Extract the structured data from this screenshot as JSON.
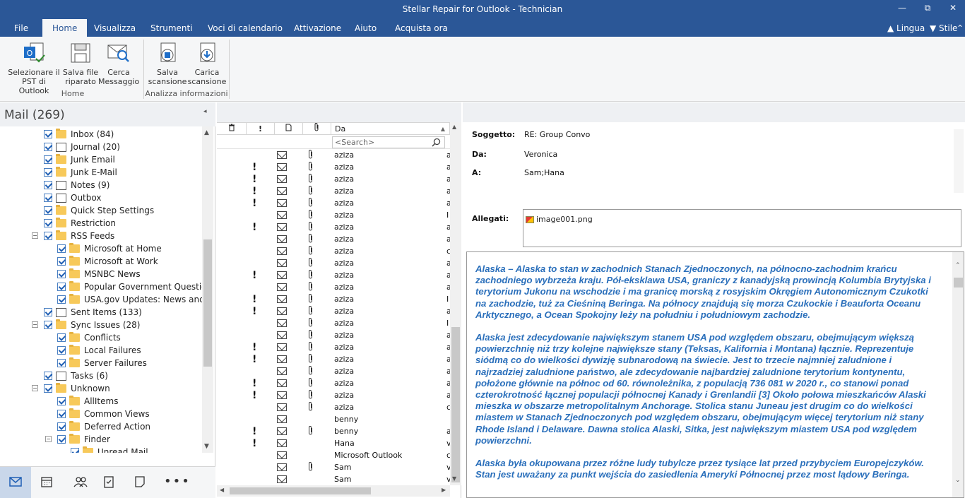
{
  "window": {
    "title": "Stellar Repair for Outlook - Technician",
    "controls": {
      "minimize": "—",
      "restore": "⧉",
      "close": "✕"
    }
  },
  "menu": {
    "items": [
      "File",
      "Home",
      "Visualizza",
      "Strumenti",
      "Voci di calendario",
      "Attivazione",
      "Aiuto",
      "Acquista ora"
    ],
    "active": "Home",
    "lingua": "▲ Lingua",
    "stile": "▼ Stile",
    "collapse": "⌃"
  },
  "ribbon": {
    "buttons": [
      {
        "line1": "Selezionare il",
        "line2": "PST di Outlook"
      },
      {
        "line1": "Salva file",
        "line2": "riparato"
      },
      {
        "line1": "Cerca",
        "line2": "Messaggio"
      },
      {
        "line1": "Salva",
        "line2": "scansione"
      },
      {
        "line1": "Carica",
        "line2": "scansione"
      }
    ],
    "groups": [
      "Home",
      "Analizza informazioni"
    ]
  },
  "left": {
    "mail_title": "Mail (269)",
    "collapse": "◂",
    "tree": [
      {
        "label": "Inbox (84)",
        "icon": "inbox",
        "indent": 1
      },
      {
        "label": "Journal (20)",
        "icon": "journal",
        "indent": 1
      },
      {
        "label": "Junk Email",
        "icon": "folder",
        "indent": 1
      },
      {
        "label": "Junk E-Mail",
        "icon": "folder",
        "indent": 1
      },
      {
        "label": "Notes (9)",
        "icon": "note",
        "indent": 1
      },
      {
        "label": "Outbox",
        "icon": "outbox",
        "indent": 1
      },
      {
        "label": "Quick Step Settings",
        "icon": "folder",
        "indent": 1
      },
      {
        "label": "Restriction",
        "icon": "folder",
        "indent": 1
      },
      {
        "label": "RSS Feeds",
        "icon": "folder",
        "indent": 1,
        "expander": "−"
      },
      {
        "label": "Microsoft at Home",
        "icon": "folder",
        "indent": 2
      },
      {
        "label": "Microsoft at Work",
        "icon": "folder",
        "indent": 2
      },
      {
        "label": "MSNBC News",
        "icon": "folder",
        "indent": 2
      },
      {
        "label": "Popular Government Questions",
        "icon": "folder",
        "indent": 2
      },
      {
        "label": "USA.gov Updates: News and Features",
        "icon": "folder",
        "indent": 2
      },
      {
        "label": "Sent Items (133)",
        "icon": "sent",
        "indent": 1
      },
      {
        "label": "Sync Issues (28)",
        "icon": "folder",
        "indent": 1,
        "expander": "−"
      },
      {
        "label": "Conflicts",
        "icon": "folder",
        "indent": 2
      },
      {
        "label": "Local Failures",
        "icon": "folder",
        "indent": 2
      },
      {
        "label": "Server Failures",
        "icon": "folder",
        "indent": 2
      },
      {
        "label": "Tasks (6)",
        "icon": "tasks",
        "indent": 1
      },
      {
        "label": "Unknown",
        "icon": "folder",
        "indent": 1,
        "expander": "−"
      },
      {
        "label": "AllItems",
        "icon": "folder",
        "indent": 2
      },
      {
        "label": "Common Views",
        "icon": "folder",
        "indent": 2
      },
      {
        "label": "Deferred Action",
        "icon": "folder",
        "indent": 2
      },
      {
        "label": "Finder",
        "icon": "folder",
        "indent": 2,
        "expander": "−"
      },
      {
        "label": "Unread Mail",
        "icon": "folder",
        "indent": 3
      }
    ],
    "nav": [
      "mail-icon",
      "calendar-icon",
      "contacts-icon",
      "tasks-icon",
      "notes-icon"
    ],
    "more": "•••"
  },
  "list": {
    "columns": {
      "from": "Da",
      "sort": "▲"
    },
    "search_placeholder": "<Search>",
    "rows": [
      {
        "imp": false,
        "clip": true,
        "from": "aziza",
        "tail": "a"
      },
      {
        "imp": true,
        "clip": true,
        "from": "aziza",
        "tail": "a"
      },
      {
        "imp": true,
        "clip": true,
        "from": "aziza",
        "tail": "a"
      },
      {
        "imp": true,
        "clip": true,
        "from": "aziza",
        "tail": "a"
      },
      {
        "imp": true,
        "clip": true,
        "from": "aziza",
        "tail": "a"
      },
      {
        "imp": false,
        "clip": true,
        "from": "aziza",
        "tail": "I"
      },
      {
        "imp": true,
        "clip": true,
        "from": "aziza",
        "tail": "a"
      },
      {
        "imp": false,
        "clip": true,
        "from": "aziza",
        "tail": "a"
      },
      {
        "imp": false,
        "clip": true,
        "from": "aziza",
        "tail": "c"
      },
      {
        "imp": false,
        "clip": true,
        "from": "aziza",
        "tail": "a"
      },
      {
        "imp": true,
        "clip": true,
        "from": "aziza",
        "tail": "a"
      },
      {
        "imp": false,
        "clip": true,
        "from": "aziza",
        "tail": "a"
      },
      {
        "imp": true,
        "clip": true,
        "from": "aziza",
        "tail": "I"
      },
      {
        "imp": true,
        "clip": true,
        "from": "aziza",
        "tail": "a"
      },
      {
        "imp": false,
        "clip": true,
        "from": "aziza",
        "tail": "I"
      },
      {
        "imp": false,
        "clip": true,
        "from": "aziza",
        "tail": "a"
      },
      {
        "imp": true,
        "clip": true,
        "from": "aziza",
        "tail": "a"
      },
      {
        "imp": true,
        "clip": true,
        "from": "aziza",
        "tail": "a"
      },
      {
        "imp": false,
        "clip": true,
        "from": "aziza",
        "tail": "a"
      },
      {
        "imp": true,
        "clip": true,
        "from": "aziza",
        "tail": "a"
      },
      {
        "imp": true,
        "clip": true,
        "from": "aziza",
        "tail": "a"
      },
      {
        "imp": false,
        "clip": true,
        "from": "aziza",
        "tail": "c"
      },
      {
        "imp": false,
        "clip": false,
        "from": "benny",
        "tail": ""
      },
      {
        "imp": true,
        "clip": true,
        "from": "benny",
        "tail": "a"
      },
      {
        "imp": true,
        "clip": false,
        "from": "Hana",
        "tail": "v"
      },
      {
        "imp": false,
        "clip": false,
        "from": "Microsoft Outlook",
        "tail": "c"
      },
      {
        "imp": false,
        "clip": true,
        "from": "Sam",
        "tail": "v"
      },
      {
        "imp": false,
        "clip": false,
        "from": "Sam",
        "tail": "v"
      }
    ]
  },
  "reading": {
    "subject_label": "Soggetto:",
    "subject": "RE: Group Convo",
    "from_label": "Da:",
    "from": "Veronica",
    "to_label": "A:",
    "to": "Sam;Hana",
    "attach_label": "Allegati:",
    "attachment": "image001.png",
    "body": [
      "Alaska – Alaska to stan w zachodnich Stanach Zjednoczonych, na północno-zachodnim krańcu zachodniego wybrzeża kraju. Pół-eksklawa USA, graniczy z kanadyjską prowincją Kolumbia Brytyjska i terytorium Jukonu na wschodzie i ma granicę morską z rosyjskim Okręgiem Autonomicznym Czukotki na zachodzie, tuż za Cieśniną Beringa. Na północy znajdują się morza Czukockie i Beauforta Oceanu Arktycznego, a Ocean Spokojny leży na południu i południowym zachodzie.",
      "Alaska jest zdecydowanie największym stanem USA pod względem obszaru, obejmującym większą powierzchnię niż trzy kolejne największe stany (Teksas, Kalifornia i Montana) łącznie. Reprezentuje siódmą co do wielkości dywizję subnarodową na świecie. Jest to trzecie najmniej zaludnione i najrzadziej zaludnione państwo, ale zdecydowanie najbardziej zaludnione terytorium kontynentu, położone głównie na północ od 60. równoleżnika, z populacją 736 081 w 2020 r., co stanowi ponad czterokrotność łącznej populacji północnej Kanady i Grenlandii [3] Około połowa mieszkańców Alaski mieszka w obszarze metropolitalnym Anchorage. Stolica stanu Juneau jest drugim co do wielkości miastem w Stanach Zjednoczonych pod względem obszaru, obejmującym więcej terytorium niż stany Rhode Island i Delaware. Dawna stolica Alaski, Sitka, jest największym miastem USA pod względem powierzchni.",
      "Alaska była okupowana przez różne ludy tubylcze przez tysiące lat przed przybyciem Europejczyków. Stan jest uważany za punkt wejścia do zasiedlenia Ameryki Północnej przez most lądowy Beringa."
    ]
  }
}
